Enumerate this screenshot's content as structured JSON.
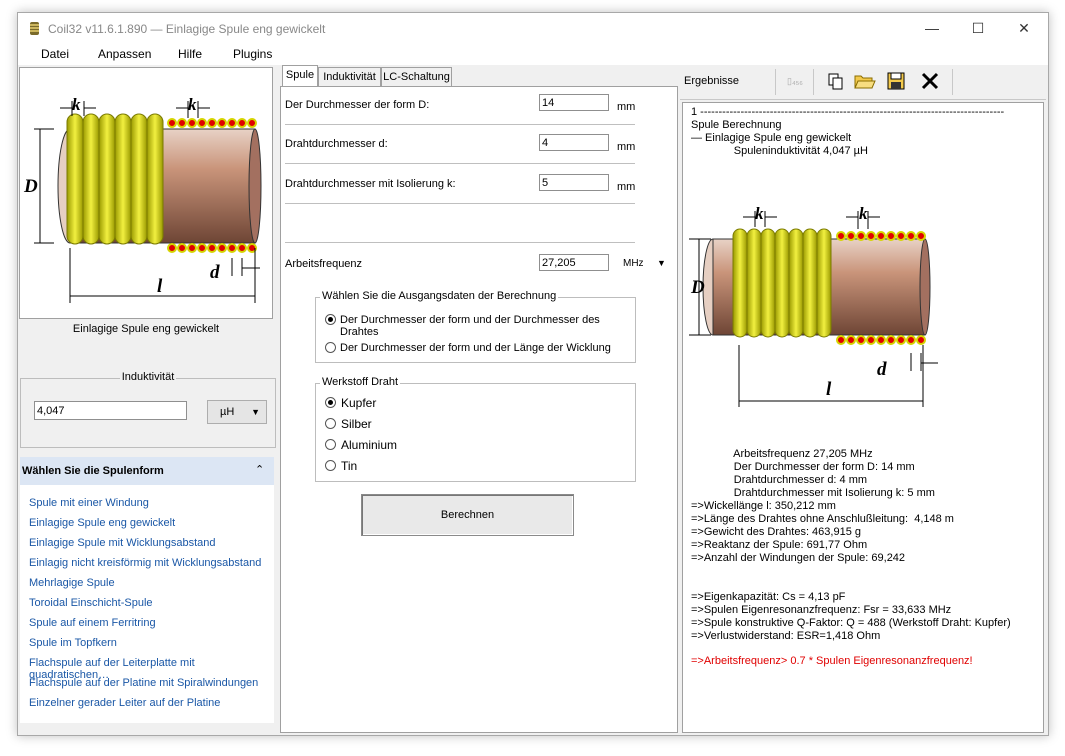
{
  "window": {
    "title": "Coil32 v11.6.1.890 — Einlagige Spule eng gewickelt",
    "controls": {
      "minimize": "—",
      "maximize": "☐",
      "close": "✕"
    }
  },
  "menu": [
    "Datei",
    "Anpassen",
    "Hilfe",
    "Plugins"
  ],
  "left": {
    "image_caption": "Einlagige Spule eng gewickelt",
    "inductance": {
      "title": "Induktivität",
      "value": "4,047",
      "unit": "µH"
    },
    "forms_header": "Wählen Sie die Spulenform",
    "forms": [
      "Spule mit einer Windung",
      "Einlagige Spule eng gewickelt",
      "Einlagige Spule mit Wicklungsabstand",
      "Einlagig nicht kreisförmig mit Wicklungsabstand",
      "Mehrlagige Spule",
      "Toroidal Einschicht-Spule",
      "Spule auf einem Ferritring",
      "Spule im Topfkern",
      "Flachspule auf der Leiterplatte mit quadratischen…",
      "Flachspule auf der Platine mit Spiralwindungen",
      "Einzelner gerader Leiter auf der Platine"
    ]
  },
  "diagram": {
    "k": "k",
    "D": "D",
    "d": "d",
    "l": "l"
  },
  "tabs": [
    "Spule",
    "Induktivität",
    "LC-Schaltung"
  ],
  "form": {
    "fields": [
      {
        "label": "Der Durchmesser der form D:",
        "value": "14",
        "unit": "mm"
      },
      {
        "label": "Drahtdurchmesser d:",
        "value": "4",
        "unit": "mm"
      },
      {
        "label": "Drahtdurchmesser mit Isolierung k:",
        "value": "5",
        "unit": "mm"
      }
    ],
    "frequency": {
      "label": "Arbeitsfrequenz",
      "value": "27,205",
      "unit": "MHz"
    },
    "source_group": {
      "title": "Wählen Sie die Ausgangsdaten der Berechnung",
      "options": [
        "Der Durchmesser der form und der Durchmesser des Drahtes",
        "Der Durchmesser der form und der Länge der Wicklung"
      ]
    },
    "material_group": {
      "title": "Werkstoff Draht",
      "options": [
        "Kupfer",
        "Silber",
        "Aluminium",
        "Tin"
      ]
    },
    "calc_button": "Berechnen"
  },
  "results": {
    "title": "Ergebnisse",
    "lines_top": [
      "1 -----------------------------------------------------------------------------------",
      "Spule Berechnung",
      "— Einlagige Spule eng gewickelt",
      "              Spuleninduktivität 4,047 µH"
    ],
    "lines_params": [
      "              Arbeitsfrequenz 27,205 MHz",
      "              Der Durchmesser der form D: 14 mm",
      "              Drahtdurchmesser d: 4 mm",
      "              Drahtdurchmesser mit Isolierung k: 5 mm",
      "=>Wickellänge l: 350,212 mm",
      "=>Länge des Drahtes ohne Anschlußleitung:  4,148 m",
      "=>Gewicht des Drahtes: 463,915 g",
      "=>Reaktanz der Spule: 691,77 Ohm",
      "=>Anzahl der Windungen der Spule: 69,242"
    ],
    "lines_extra": [
      "=>Eigenkapazität: Cs = 4,13 pF",
      "=>Spulen Eigenresonanzfrequenz: Fsr = 33,633 MHz",
      "=>Spule konstruktive Q-Faktor: Q = 488 (Werkstoff Draht: Kupfer)",
      "=>Verlustwiderstand: ESR=1,418 Ohm"
    ],
    "warning": "=>Arbeitsfrequenz> 0.7 * Spulen Eigenresonanzfrequenz!",
    "warning_color": "#e00000"
  },
  "colors": {
    "link": "#1a57a6",
    "wire": "#d6d400",
    "pipe": "#c89478"
  }
}
